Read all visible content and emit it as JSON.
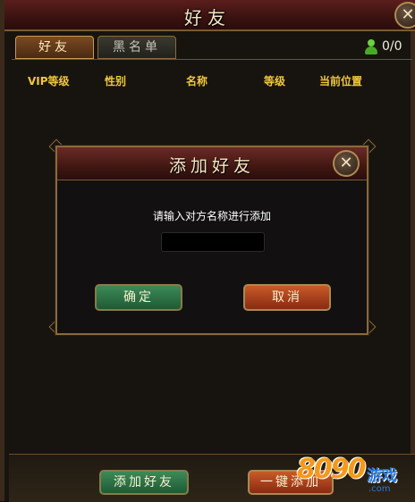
{
  "window": {
    "title": "好友",
    "close_label": "✕"
  },
  "tabs": [
    {
      "label": "好友",
      "active": true
    },
    {
      "label": "黑名单",
      "active": false
    }
  ],
  "online_count": "0/0",
  "columns": [
    "VIP等级",
    "性别",
    "名称",
    "等级",
    "当前位置"
  ],
  "dialog": {
    "title": "添加好友",
    "close_label": "✕",
    "prompt": "请输入对方名称进行添加",
    "input_value": "",
    "confirm_label": "确定",
    "cancel_label": "取消"
  },
  "bottom": {
    "add_friend_label": "添加好友",
    "one_click_add_label": "一键添加"
  },
  "watermark": {
    "number": "8090",
    "text": "游戏",
    "domain": ".com"
  },
  "colors": {
    "accent_gold": "#f0c83a",
    "title_red": "#5a1e1c",
    "confirm_green": "#2f7a4a",
    "cancel_red": "#b04a22"
  }
}
